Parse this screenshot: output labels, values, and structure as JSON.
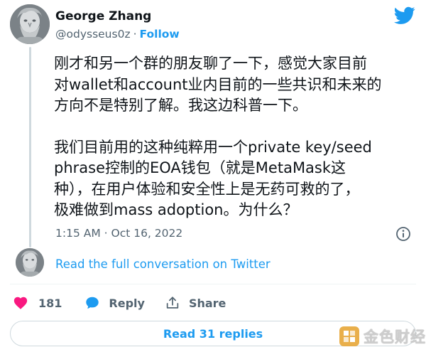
{
  "colors": {
    "brand_blue": "#1d9bf0",
    "like_red": "#f91880",
    "muted_text": "#536471",
    "border": "#cfd9de"
  },
  "tweet": {
    "author": {
      "name": "George Zhang",
      "handle": "@odysseus0z",
      "separator": "·",
      "follow_label": "Follow",
      "avatar_icon": "bust-statue-avatar"
    },
    "logo_icon": "twitter-bird-icon",
    "paragraphs": [
      "刚才和另一个群的朋友聊了一下，感觉大家目前\n对wallet和account业内目前的一些共识和未来的\n方向不是特别了解。我这边科普一下。",
      "我们目前用的这种纯粹用一个private key/seed\nphrase控制的EOA钱包（就是MetaMask这\n种），在用户体验和安全性上是无药可救的了，\n极难做到mass adoption。为什么？"
    ],
    "timestamp": "1:15 AM · Oct 16, 2022",
    "info_icon": "info-icon"
  },
  "thread": {
    "full_conversation_label": "Read the full conversation on Twitter"
  },
  "actions": {
    "like_count": "181",
    "reply_label": "Reply",
    "share_label": "Share"
  },
  "replies_button": {
    "label": "Read 31 replies"
  },
  "watermark": {
    "text": "金色财经"
  }
}
